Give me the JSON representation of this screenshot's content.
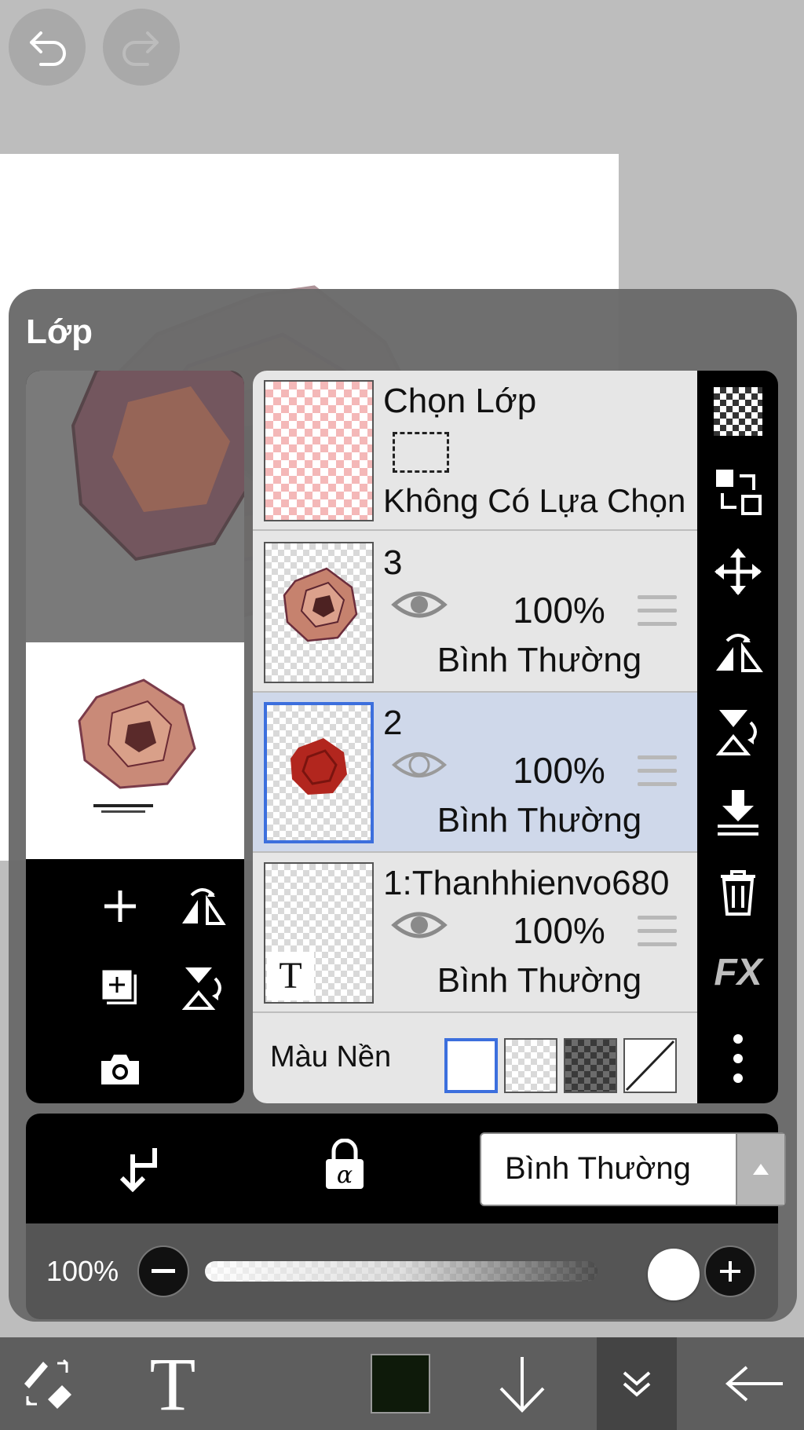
{
  "panel": {
    "title": "Lớp"
  },
  "layers": [
    {
      "name": "Chọn Lớp",
      "subtitle": "Không Có Lựa Chọn"
    },
    {
      "name": "3",
      "opacity": "100%",
      "blend": "Bình Thường",
      "thumb": "rose-color-icon"
    },
    {
      "name": "2",
      "opacity": "100%",
      "blend": "Bình Thường",
      "thumb": "rose-red-icon",
      "selected": true
    },
    {
      "name": "1:Thanhhienvo680",
      "opacity": "100%",
      "blend": "Bình Thường",
      "thumb": "text-layer-icon",
      "thumb_text": "T"
    }
  ],
  "background_color": {
    "label": "Màu Nền",
    "options": [
      "white",
      "transparent",
      "dark-checker",
      "none"
    ],
    "selected": "white"
  },
  "blend_mode": {
    "value": "Bình Thường"
  },
  "opacity_slider": {
    "label": "100%",
    "value": 1.0
  },
  "toolbar": {
    "text_tool_label": "T",
    "current_color": "#0e1a0a"
  },
  "colors": {
    "selection_blue": "#3c6fdd",
    "selected_row": "#cfd8ea"
  }
}
